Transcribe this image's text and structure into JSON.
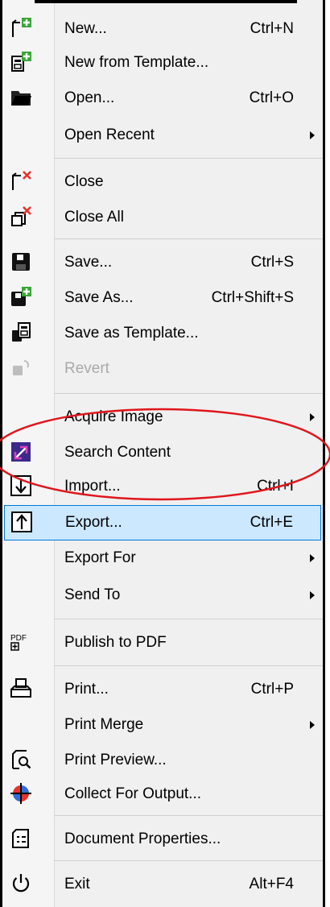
{
  "menu": {
    "items": [
      {
        "label": "New...",
        "shortcut": "Ctrl+N",
        "icon": "new-document-icon"
      },
      {
        "label": "New from Template...",
        "shortcut": "",
        "icon": "new-from-template-icon"
      },
      {
        "label": "Open...",
        "shortcut": "Ctrl+O",
        "icon": "open-folder-icon"
      },
      {
        "label": "Open Recent",
        "shortcut": "",
        "icon": ""
      },
      {
        "label": "Close",
        "shortcut": "",
        "icon": "close-document-icon"
      },
      {
        "label": "Close All",
        "shortcut": "",
        "icon": "close-all-icon"
      },
      {
        "label": "Save...",
        "shortcut": "Ctrl+S",
        "icon": "save-icon"
      },
      {
        "label": "Save As...",
        "shortcut": "Ctrl+Shift+S",
        "icon": "save-as-icon"
      },
      {
        "label": "Save as Template...",
        "shortcut": "",
        "icon": "save-as-template-icon"
      },
      {
        "label": "Revert",
        "shortcut": "",
        "icon": "revert-icon"
      },
      {
        "label": "Acquire Image",
        "shortcut": "",
        "icon": ""
      },
      {
        "label": "Search Content",
        "shortcut": "",
        "icon": "search-content-icon"
      },
      {
        "label": "Import...",
        "shortcut": "Ctrl+I",
        "icon": "import-icon"
      },
      {
        "label": "Export...",
        "shortcut": "Ctrl+E",
        "icon": "export-icon"
      },
      {
        "label": "Export For",
        "shortcut": "",
        "icon": ""
      },
      {
        "label": "Send To",
        "shortcut": "",
        "icon": ""
      },
      {
        "label": "Publish to PDF",
        "shortcut": "",
        "icon": "pdf-icon",
        "icon_text": "PDF"
      },
      {
        "label": "Print...",
        "shortcut": "Ctrl+P",
        "icon": "printer-icon"
      },
      {
        "label": "Print Merge",
        "shortcut": "",
        "icon": ""
      },
      {
        "label": "Print Preview...",
        "shortcut": "",
        "icon": "print-preview-icon"
      },
      {
        "label": "Collect For Output...",
        "shortcut": "",
        "icon": "collect-for-output-icon"
      },
      {
        "label": "Document Properties...",
        "shortcut": "",
        "icon": "document-properties-icon"
      },
      {
        "label": "Exit",
        "shortcut": "Alt+F4",
        "icon": "power-icon"
      }
    ]
  },
  "colors": {
    "highlight_bg": "#cce8ff",
    "highlight_border": "#0078d7",
    "annotation": "#e0151b",
    "icon_green": "#3aa53a",
    "icon_red": "#e5322d"
  }
}
